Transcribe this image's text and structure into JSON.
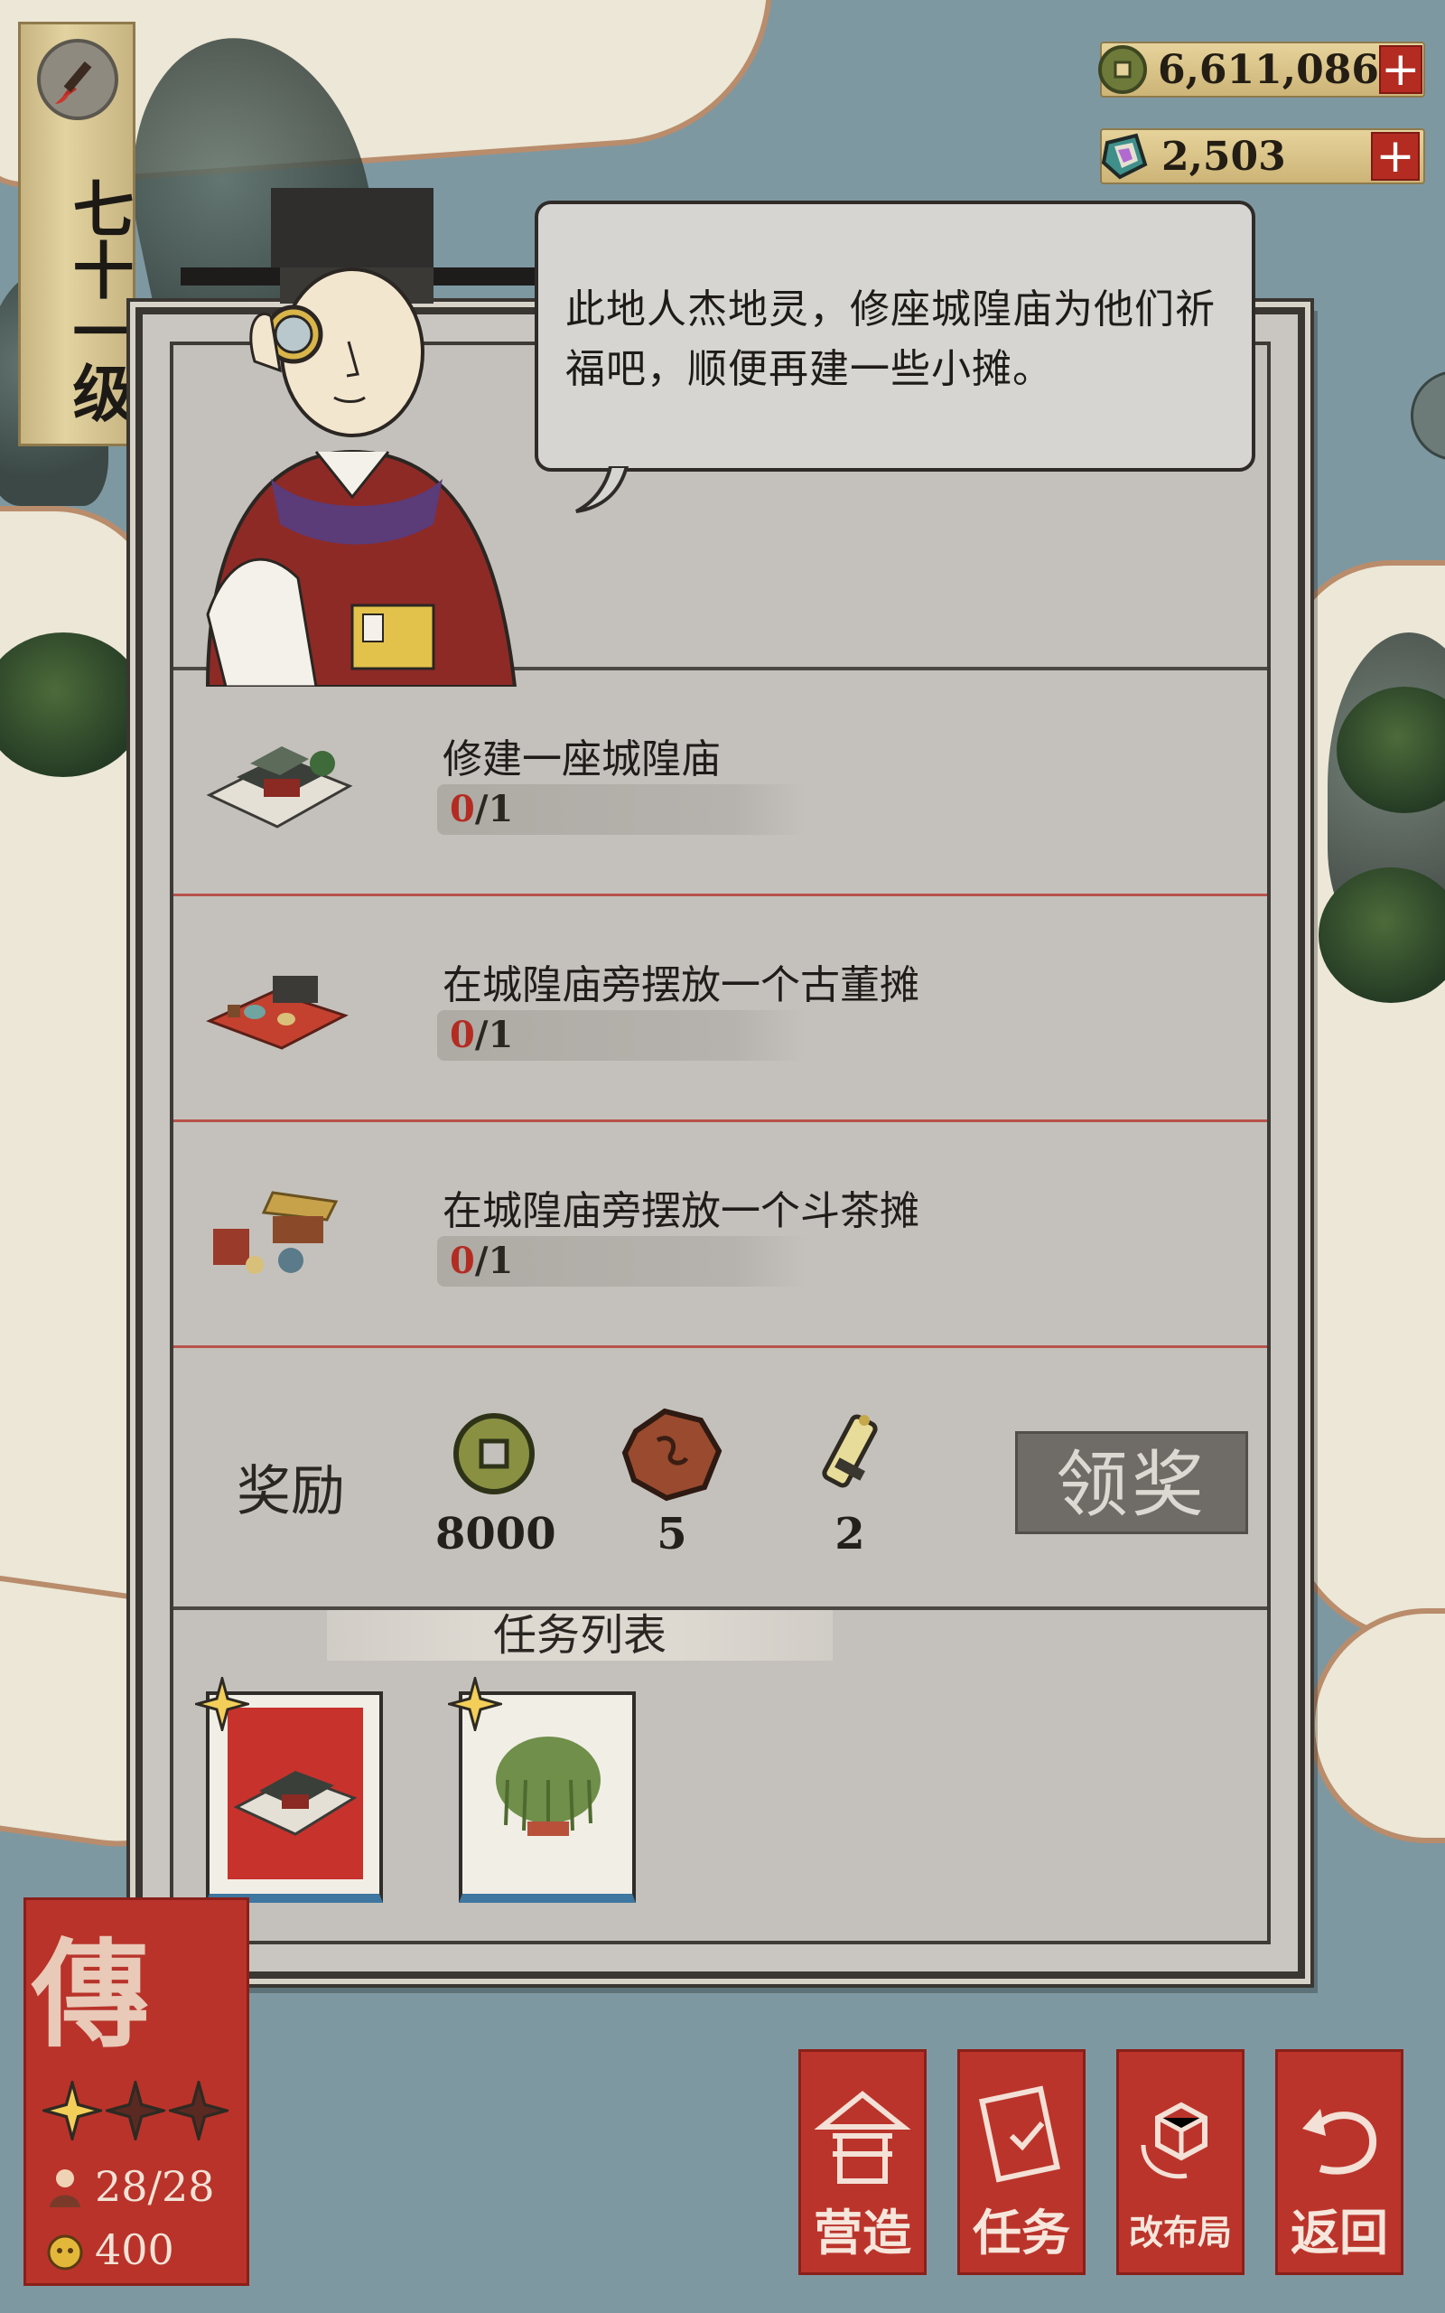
{
  "currency": {
    "coins": "6,611,086",
    "gems": "2,503",
    "plus_label": "+"
  },
  "level": {
    "label": "七十一级",
    "icon": "brush-icon"
  },
  "dialog": {
    "speech": "此地人杰地灵，修座城隍庙为他们祈福吧，顺便再建一些小摊。",
    "tasks": [
      {
        "title": "修建一座城隍庙",
        "current": "0",
        "total": "/1",
        "icon": "temple-icon"
      },
      {
        "title": "在城隍庙旁摆放一个古董摊",
        "current": "0",
        "total": "/1",
        "icon": "antique-stall-icon"
      },
      {
        "title": "在城隍庙旁摆放一个斗茶摊",
        "current": "0",
        "total": "/1",
        "icon": "tea-stall-icon"
      }
    ],
    "reward": {
      "label": "奖励",
      "items": [
        {
          "icon": "copper-coin-icon",
          "amount": "8000"
        },
        {
          "icon": "ore-icon",
          "amount": "5"
        },
        {
          "icon": "scroll-icon",
          "amount": "2"
        }
      ],
      "claim_label": "领奖"
    },
    "task_list": {
      "header": "任务列表",
      "cards": [
        {
          "icon": "temple-card-icon",
          "bg": "#c8322c"
        },
        {
          "icon": "willow-tree-card-icon",
          "bg": "#f1eee6"
        }
      ]
    }
  },
  "legend_card": {
    "char": "傳",
    "stars_lit": 1,
    "stars_total": 3,
    "workers": "28/28",
    "coins": "400"
  },
  "nav": [
    {
      "label": "营造",
      "icon": "build-icon"
    },
    {
      "label": "任务",
      "icon": "task-book-icon"
    },
    {
      "label": "改布局",
      "icon": "layout-icon"
    },
    {
      "label": "返回",
      "icon": "return-icon"
    }
  ],
  "colors": {
    "accent_red": "#b42b22",
    "water": "#7e98a2",
    "paper": "#c4c1bc"
  }
}
